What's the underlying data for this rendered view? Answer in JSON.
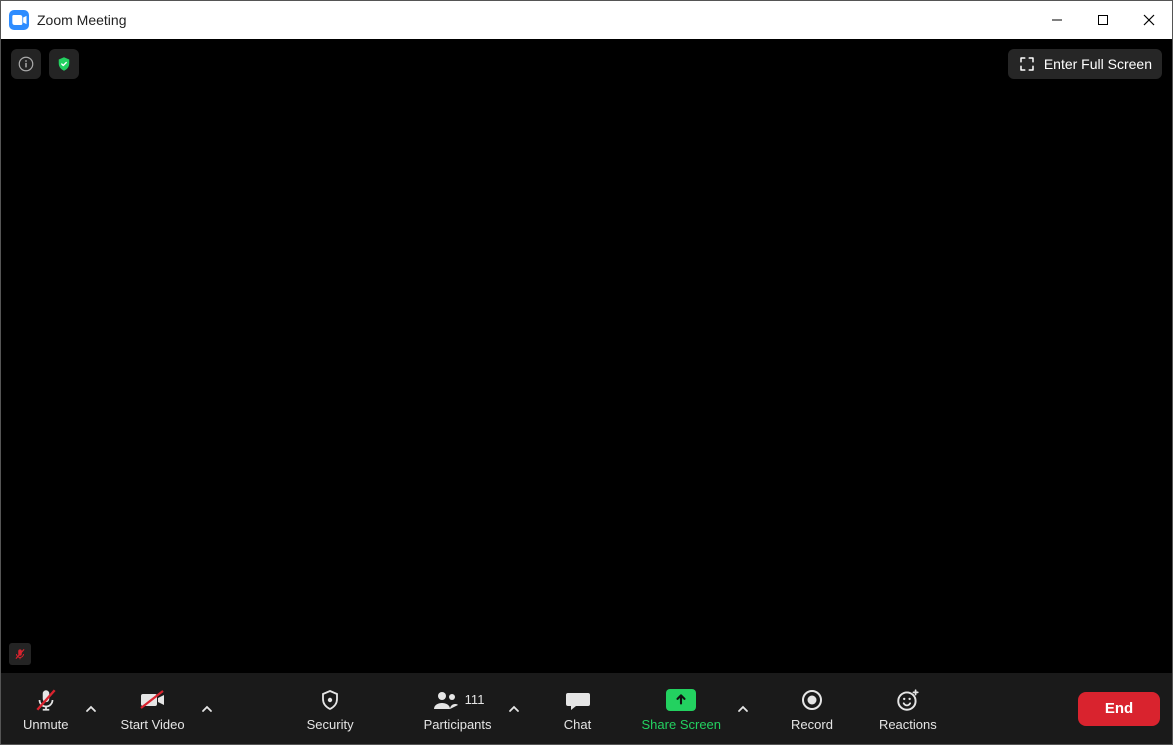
{
  "window": {
    "title": "Zoom Meeting"
  },
  "top": {
    "fullscreen_label": "Enter Full Screen"
  },
  "toolbar": {
    "unmute": "Unmute",
    "start_video": "Start Video",
    "security": "Security",
    "participants": "Participants",
    "participants_count": "111",
    "chat": "Chat",
    "share_screen": "Share Screen",
    "record": "Record",
    "reactions": "Reactions",
    "end": "End"
  },
  "colors": {
    "accent_green": "#23D160",
    "end_red": "#d9232e",
    "zoom_blue": "#2D8CFF"
  }
}
